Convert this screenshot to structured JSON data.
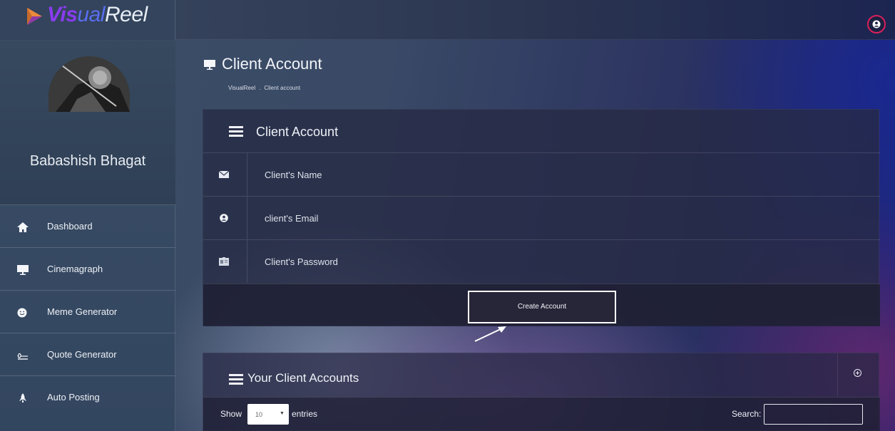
{
  "brand": {
    "part1": "Vis",
    "part2": "ual",
    "part3": "Reel"
  },
  "user": {
    "name": "Babashish Bhagat"
  },
  "sidebar": {
    "items": [
      {
        "label": "Dashboard",
        "icon": "home-icon"
      },
      {
        "label": "Cinemagraph",
        "icon": "monitor-icon"
      },
      {
        "label": "Meme Generator",
        "icon": "smiley-icon"
      },
      {
        "label": "Quote Generator",
        "icon": "signature-icon"
      },
      {
        "label": "Auto Posting",
        "icon": "rocket-icon"
      }
    ]
  },
  "page": {
    "title": "Client Account",
    "breadcrumb": [
      "VisualReel",
      "Client account"
    ],
    "breadcrumb_sep": "."
  },
  "form": {
    "title": "Client Account",
    "fields": [
      {
        "placeholder": "Client's Name",
        "icon": "envelope-icon"
      },
      {
        "placeholder": "client's Email",
        "icon": "user-icon"
      },
      {
        "placeholder": "Client's Password",
        "icon": "id-card-icon"
      }
    ],
    "submit_label": "Create Account"
  },
  "accounts": {
    "title": "Your Client Accounts",
    "show_label": "Show",
    "entries_value": "10",
    "entries_label": "entries",
    "search_label": "Search:",
    "search_value": ""
  },
  "colors": {
    "accent_user_ring": "#d9205b",
    "brand_primary": "#8a3cf0",
    "brand_secondary": "#5a6ef0"
  }
}
